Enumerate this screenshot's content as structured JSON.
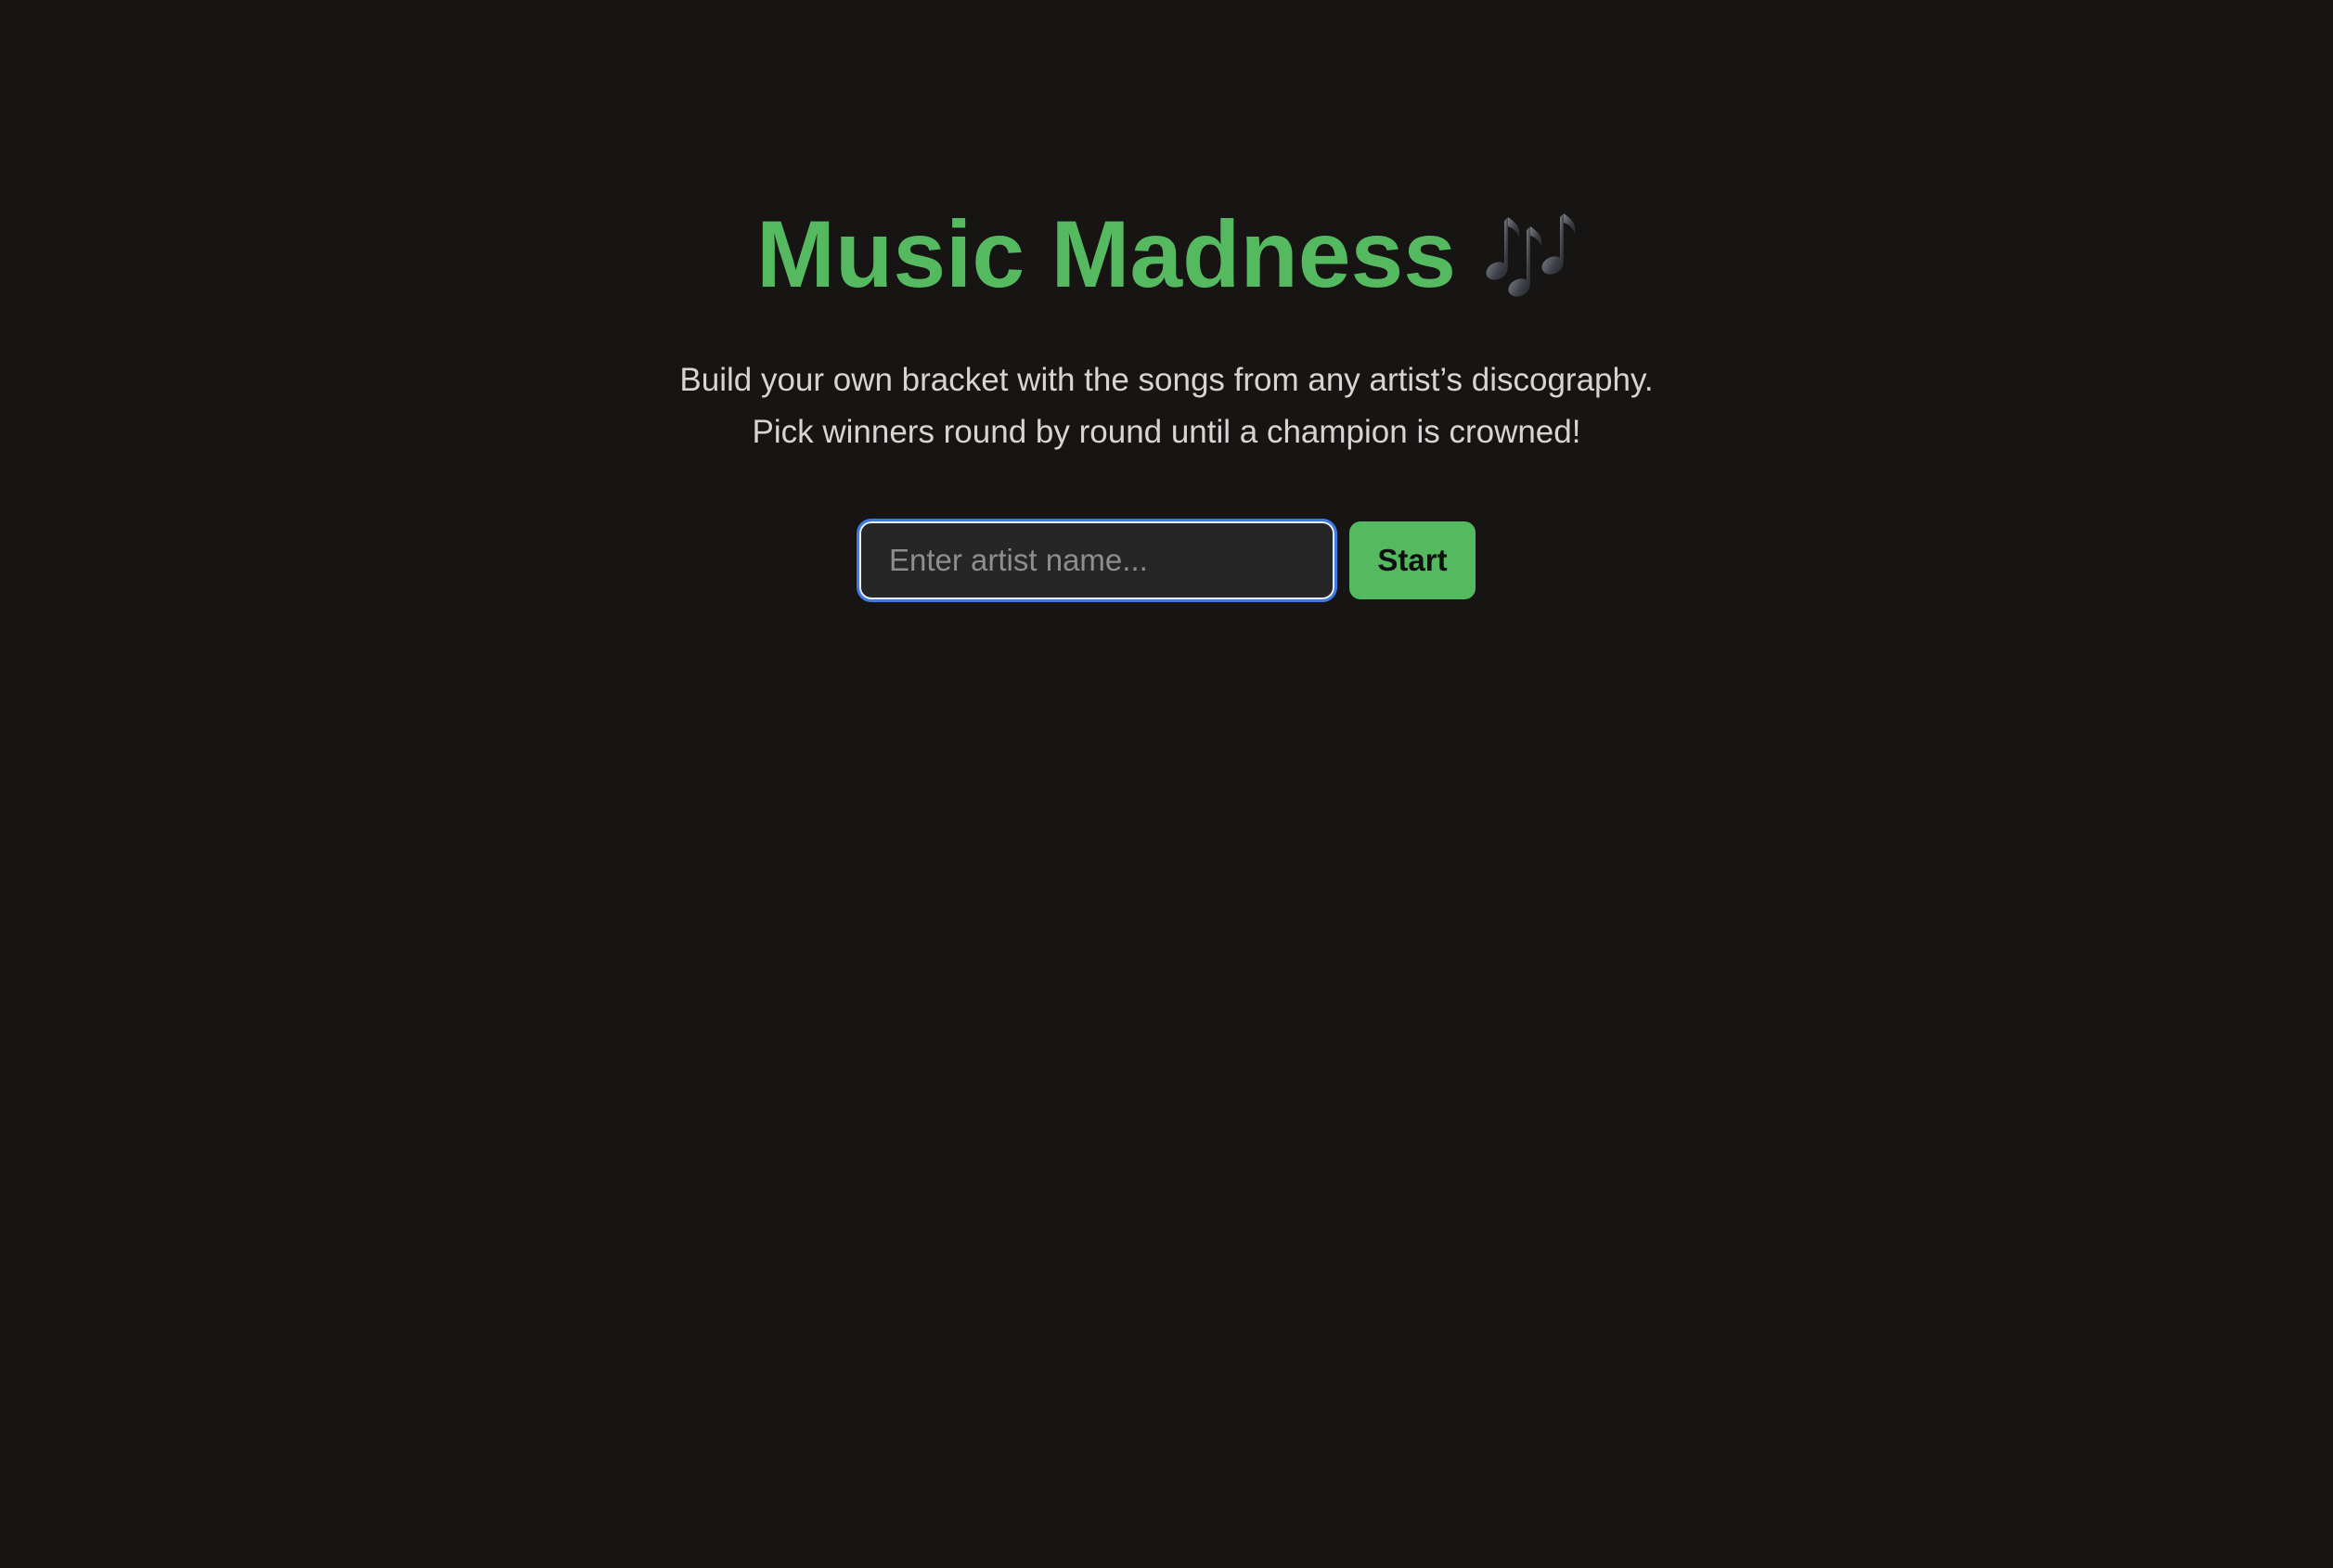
{
  "app": {
    "title": "Music Madness",
    "title_icon": "musical-notes-icon",
    "subtitle_line1": "Build your own bracket with the songs from any artist’s discography.",
    "subtitle_line2": "Pick winners round by round until a champion is crowned!"
  },
  "search": {
    "value": "",
    "placeholder": "Enter artist name...",
    "start_label": "Start"
  },
  "colors": {
    "background": "#171514",
    "accent": "#55b960",
    "text": "#d7d5d3",
    "input_background": "#262626",
    "focus_ring": "#3f7ae0"
  }
}
